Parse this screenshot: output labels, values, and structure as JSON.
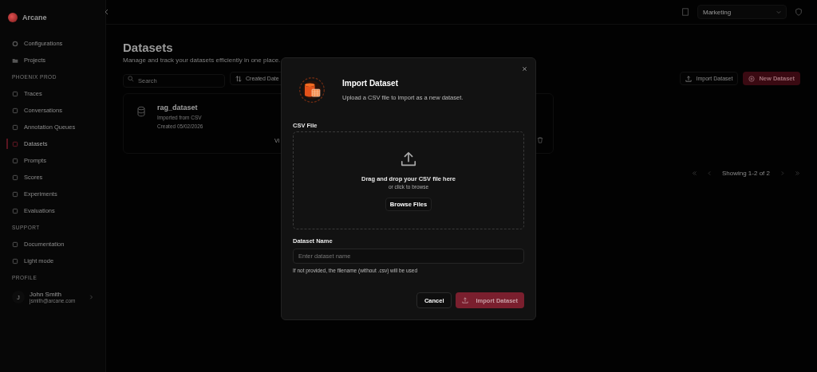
{
  "sidebar": {
    "brand": "Arcane",
    "top_items": [
      {
        "label": "Configurations",
        "selected": false
      },
      {
        "label": "Projects",
        "selected": false
      }
    ],
    "sections": [
      {
        "title": "PHOENIX PROD",
        "items": [
          {
            "label": "Traces",
            "selected": false
          },
          {
            "label": "Conversations",
            "selected": false
          },
          {
            "label": "Annotation Queues",
            "selected": false
          },
          {
            "label": "Datasets",
            "selected": true
          },
          {
            "label": "Prompts",
            "selected": false
          },
          {
            "label": "Scores",
            "selected": false
          },
          {
            "label": "Experiments",
            "selected": false
          },
          {
            "label": "Evaluations",
            "selected": false
          }
        ]
      },
      {
        "title": "SUPPORT",
        "items": [
          {
            "label": "Documentation",
            "selected": false
          },
          {
            "label": "Light mode",
            "selected": false
          }
        ]
      }
    ],
    "profile_title": "PROFILE",
    "profile": {
      "initial": "J",
      "name": "John Smith",
      "email": "jsmith@arcane.com"
    }
  },
  "topbar": {
    "workspace": "Marketing"
  },
  "page": {
    "title": "Datasets",
    "subtitle": "Manage and track your datasets efficiently in one place.",
    "search_placeholder": "Search",
    "sort_label": "Created Date",
    "import_button": "Import Dataset",
    "new_button": "New Dataset",
    "datasets": [
      {
        "name": "rag_dataset",
        "source": "Imported from CSV",
        "created": "Created 05/02/2026",
        "view_link": "Vi"
      }
    ],
    "pagination": "Showing 1-2 of 2"
  },
  "dialog": {
    "title": "Import Dataset",
    "subtitle": "Upload a CSV file to import as a new dataset.",
    "file_label": "CSV File",
    "drop_text": "Drag and drop your CSV file here",
    "drop_hint": "or click to browse",
    "browse_button": "Browse Files",
    "name_label": "Dataset Name",
    "name_placeholder": "Enter dataset name",
    "name_help": "If not provided, the filename (without .csv) will be used",
    "cancel_button": "Cancel",
    "submit_button": "Import Dataset",
    "submit_disabled": true
  }
}
